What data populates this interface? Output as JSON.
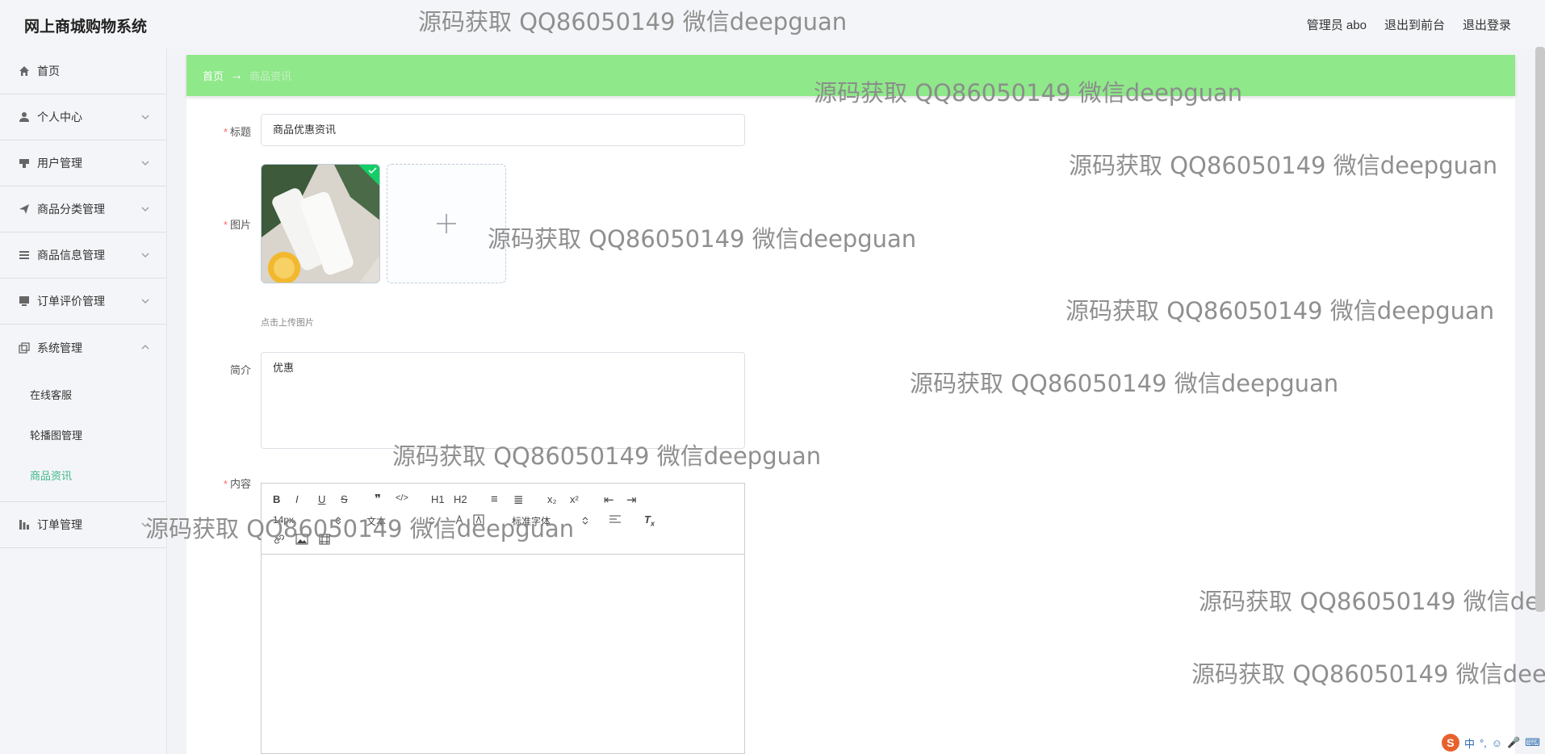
{
  "header": {
    "brand": "网上商城购物系统",
    "links": [
      "管理员 abo",
      "退出到前台",
      "退出登录"
    ]
  },
  "sidebar": {
    "items": [
      {
        "label": "首页",
        "icon": "home-icon"
      },
      {
        "label": "个人中心",
        "icon": "user-icon"
      },
      {
        "label": "用户管理",
        "icon": "stamp-icon"
      },
      {
        "label": "商品分类管理",
        "icon": "send-icon"
      },
      {
        "label": "商品信息管理",
        "icon": "list-icon"
      },
      {
        "label": "订单评价管理",
        "icon": "monitor-icon"
      },
      {
        "label": "系统管理",
        "icon": "copy-icon"
      }
    ],
    "system_sub": [
      "在线客服",
      "轮播图管理",
      "商品资讯"
    ],
    "last_item": {
      "label": "订单管理",
      "icon": "chart-icon"
    }
  },
  "breadcrumb": {
    "home": "首页",
    "arrow": "→",
    "current": "商品资讯"
  },
  "form": {
    "title_label": "标题",
    "title_value": "商品优惠资讯",
    "image_label": "图片",
    "upload_hint": "点击上传图片",
    "intro_label": "简介",
    "intro_value": "优惠",
    "content_label": "内容"
  },
  "editor": {
    "row1": [
      "B",
      "I",
      "U",
      "S",
      "❞",
      "</>",
      "H1",
      "H2",
      "≡",
      "≣",
      "x₂",
      "x²",
      "⇤",
      "⇥"
    ],
    "size": "14px",
    "paragraph": "文本",
    "font": "标准字体"
  },
  "watermark": "源码获取 QQ86050149 微信deepguan",
  "tray": [
    "中",
    "°,",
    "☺",
    "🎤",
    "⌨"
  ],
  "colors": {
    "accent": "#3fb88a",
    "breadcrumb_bg": "#8fe88a",
    "required": "#f56c6c"
  }
}
